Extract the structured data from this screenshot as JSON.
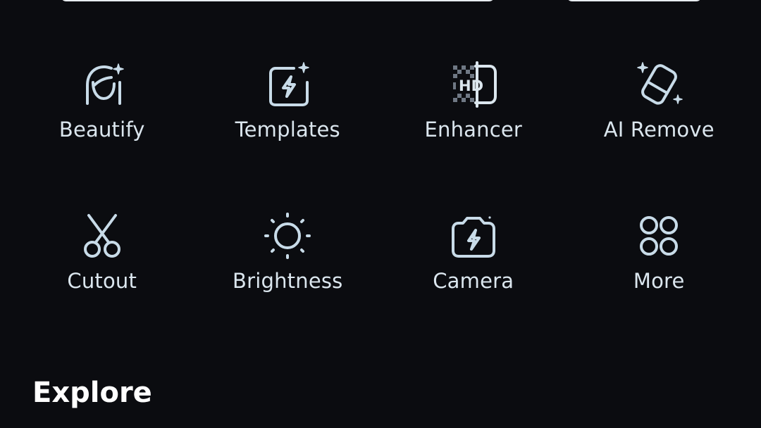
{
  "tools": [
    {
      "label": "Beautify",
      "icon": "beautify-face-sparkle-icon"
    },
    {
      "label": "Templates",
      "icon": "templates-lightning-frame-icon"
    },
    {
      "label": "Enhancer",
      "icon": "hd-enhancer-icon"
    },
    {
      "label": "AI Remove",
      "icon": "eraser-sparkle-icon"
    },
    {
      "label": "Cutout",
      "icon": "scissors-icon"
    },
    {
      "label": "Brightness",
      "icon": "sun-icon"
    },
    {
      "label": "Camera",
      "icon": "camera-lightning-icon"
    },
    {
      "label": "More",
      "icon": "four-circles-grid-icon"
    }
  ],
  "explore": {
    "title": "Explore"
  },
  "colors": {
    "background": "#0b0c10",
    "icon_stroke": "#c8dbe8",
    "label_text": "#dbe6ee",
    "heading_text": "#ffffff"
  }
}
